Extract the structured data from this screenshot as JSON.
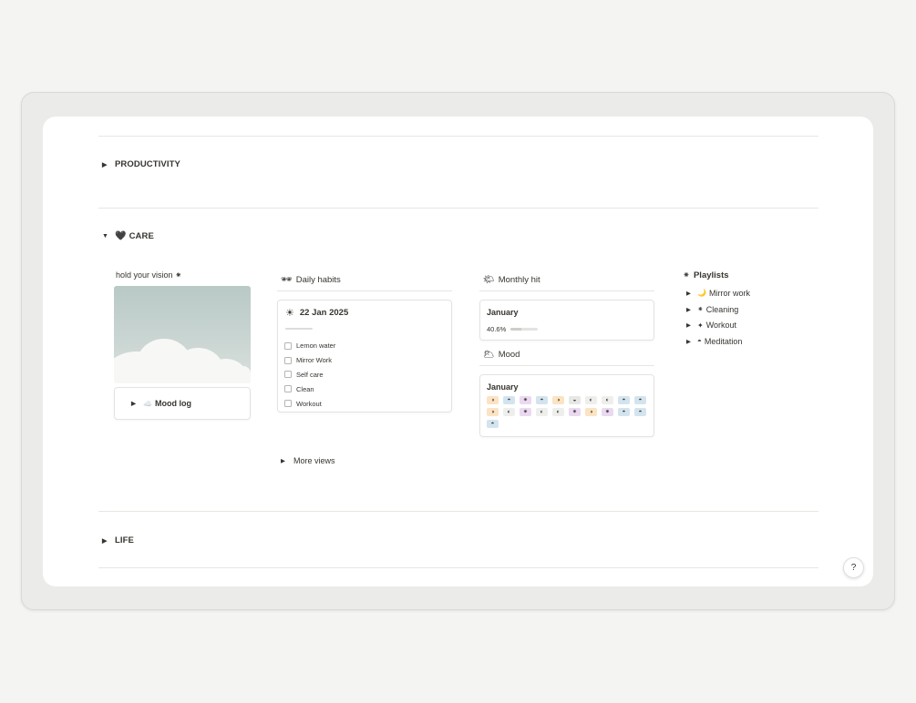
{
  "sections": {
    "productivity": {
      "label": "PRODUCTIVITY",
      "toggle": "▶"
    },
    "care": {
      "label": "CARE",
      "toggle": "▼",
      "icon": "🖤"
    },
    "life": {
      "label": "LIFE",
      "toggle": "▶"
    }
  },
  "vision": {
    "label": "hold your  vision ⁕"
  },
  "mood_log": {
    "label": "Mood log",
    "icon": "☁️",
    "toggle": "▶"
  },
  "daily_habits": {
    "heading": "Daily habits",
    "icon": "🕶",
    "date": "22 Jan 2025",
    "date_icon": "☀",
    "habits": [
      "Lemon water",
      "Mirror Work",
      "Self care",
      "Clean",
      "Workout"
    ]
  },
  "monthly_hit": {
    "heading": "Monthly hit",
    "icon": "🌤",
    "month": "January",
    "percent_label": "40.6%",
    "progress": 0.406
  },
  "mood": {
    "heading": "Mood",
    "icon": "🌥",
    "month": "January",
    "entries": [
      {
        "glyph": "◑",
        "color": "#fbe3c3"
      },
      {
        "glyph": "◓",
        "color": "#d3e4ef"
      },
      {
        "glyph": "⁕",
        "color": "#ead9f1"
      },
      {
        "glyph": "◓",
        "color": "#d3e4ef"
      },
      {
        "glyph": "◑",
        "color": "#fbe3c3"
      },
      {
        "glyph": "◒",
        "color": "#e7e7e5"
      },
      {
        "glyph": "◐",
        "color": "#eeeeec"
      },
      {
        "glyph": "◐",
        "color": "#eeeeec"
      },
      {
        "glyph": "◓",
        "color": "#d3e4ef"
      },
      {
        "glyph": "◓",
        "color": "#d3e4ef"
      },
      {
        "glyph": "◑",
        "color": "#fbe3c3"
      },
      {
        "glyph": "◐",
        "color": "#eeeeec"
      },
      {
        "glyph": "⁕",
        "color": "#ead9f1"
      },
      {
        "glyph": "◐",
        "color": "#eeeeec"
      },
      {
        "glyph": "◐",
        "color": "#eeeeec"
      },
      {
        "glyph": "⁕",
        "color": "#ead9f1"
      },
      {
        "glyph": "◑",
        "color": "#fbe3c3"
      },
      {
        "glyph": "⁕",
        "color": "#ead9f1"
      },
      {
        "glyph": "◓",
        "color": "#d3e4ef"
      },
      {
        "glyph": "◓",
        "color": "#d3e4ef"
      },
      {
        "glyph": "◓",
        "color": "#d3e4ef"
      }
    ]
  },
  "playlists": {
    "heading": "Playlists",
    "icon": "⁕",
    "items": [
      {
        "label": "Mirror work",
        "icon": "🌙"
      },
      {
        "label": "Cleaning",
        "icon": "⁕"
      },
      {
        "label": "Workout",
        "icon": "✦"
      },
      {
        "label": "Meditation",
        "icon": "◓"
      }
    ]
  },
  "more_views": {
    "label": "More views",
    "toggle": "▶"
  },
  "help_button": {
    "icon": "?"
  }
}
